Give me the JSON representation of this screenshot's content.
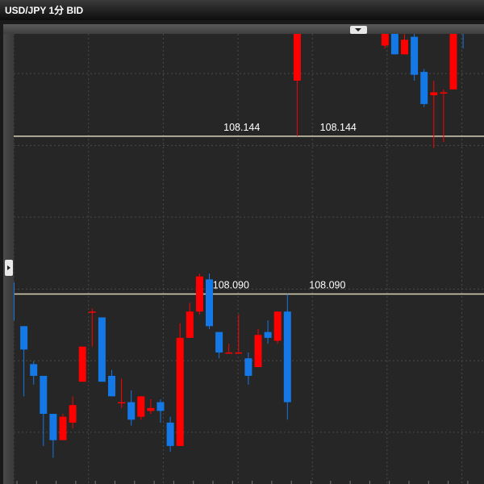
{
  "window": {
    "title": "USD/JPY 1分 BID"
  },
  "icons": {
    "dropdown": "caret-down-icon",
    "side_toggle": "caret-right-icon"
  },
  "colors": {
    "up": "#ff0000",
    "down": "#1478e6",
    "background": "#262626",
    "grid": "#4a4a4a",
    "level_line": "#d8d2b8",
    "label_text": "#ffffff"
  },
  "chart_data": {
    "type": "candlestick",
    "instrument": "USD/JPY",
    "timeframe": "1分",
    "price_type": "BID",
    "ylim": [
      108.025,
      108.179
    ],
    "bar_count": 48,
    "grid": true,
    "price_lines": [
      {
        "price": 108.144,
        "labels": [
          "108.144",
          "108.144"
        ]
      },
      {
        "price": 108.09,
        "labels": [
          "108.090",
          "108.090"
        ]
      }
    ],
    "candles": [
      {
        "o": null,
        "h": 108.094,
        "l": 108.081,
        "c": null
      },
      {
        "o": 108.079,
        "h": 108.079,
        "l": 108.055,
        "c": 108.071
      },
      {
        "o": 108.066,
        "h": 108.067,
        "l": 108.059,
        "c": 108.062
      },
      {
        "o": 108.062,
        "h": 108.062,
        "l": 108.038,
        "c": 108.049
      },
      {
        "o": 108.049,
        "h": 108.049,
        "l": 108.034,
        "c": 108.04
      },
      {
        "o": 108.04,
        "h": 108.049,
        "l": 108.04,
        "c": 108.048
      },
      {
        "o": 108.046,
        "h": 108.055,
        "l": 108.044,
        "c": 108.052
      },
      {
        "o": 108.06,
        "h": 108.072,
        "l": 108.06,
        "c": 108.072
      },
      {
        "o": 108.084,
        "h": 108.085,
        "l": 108.072,
        "c": 108.084
      },
      {
        "o": 108.082,
        "h": 108.082,
        "l": 108.06,
        "c": 108.06
      },
      {
        "o": 108.062,
        "h": 108.064,
        "l": 108.055,
        "c": 108.055
      },
      {
        "o": 108.053,
        "h": 108.061,
        "l": 108.051,
        "c": 108.053
      },
      {
        "o": 108.053,
        "h": 108.057,
        "l": 108.045,
        "c": 108.047
      },
      {
        "o": 108.048,
        "h": 108.055,
        "l": 108.047,
        "c": 108.055
      },
      {
        "o": 108.05,
        "h": 108.054,
        "l": 108.049,
        "c": 108.051
      },
      {
        "o": 108.053,
        "h": 108.054,
        "l": 108.046,
        "c": 108.05
      },
      {
        "o": 108.046,
        "h": 108.048,
        "l": 108.036,
        "c": 108.038
      },
      {
        "o": 108.038,
        "h": 108.08,
        "l": 108.038,
        "c": 108.075
      },
      {
        "o": 108.075,
        "h": 108.087,
        "l": 108.075,
        "c": 108.084
      },
      {
        "o": 108.084,
        "h": 108.097,
        "l": 108.083,
        "c": 108.096
      },
      {
        "o": 108.095,
        "h": 108.097,
        "l": 108.078,
        "c": 108.079
      },
      {
        "o": 108.077,
        "h": 108.077,
        "l": 108.068,
        "c": 108.07
      },
      {
        "o": 108.07,
        "h": 108.073,
        "l": 108.07,
        "c": 108.07
      },
      {
        "o": 108.07,
        "h": 108.083,
        "l": 108.07,
        "c": 108.07
      },
      {
        "o": 108.068,
        "h": 108.07,
        "l": 108.059,
        "c": 108.062
      },
      {
        "o": 108.065,
        "h": 108.078,
        "l": 108.065,
        "c": 108.076
      },
      {
        "o": 108.077,
        "h": 108.081,
        "l": 108.073,
        "c": 108.075
      },
      {
        "o": 108.074,
        "h": 108.083,
        "l": 108.073,
        "c": 108.084
      },
      {
        "o": 108.084,
        "h": 108.09,
        "l": 108.047,
        "c": 108.053
      },
      {
        "o": 108.163,
        "h": 108.179,
        "l": 108.144,
        "c": 108.179
      },
      {
        "o": null,
        "h": null,
        "l": null,
        "c": null
      },
      {
        "o": null,
        "h": null,
        "l": null,
        "c": null
      },
      {
        "o": null,
        "h": null,
        "l": null,
        "c": null
      },
      {
        "o": null,
        "h": null,
        "l": null,
        "c": null
      },
      {
        "o": null,
        "h": null,
        "l": null,
        "c": null
      },
      {
        "o": null,
        "h": null,
        "l": null,
        "c": null
      },
      {
        "o": null,
        "h": null,
        "l": null,
        "c": null
      },
      {
        "o": null,
        "h": null,
        "l": null,
        "c": null
      },
      {
        "o": 108.175,
        "h": 108.179,
        "l": 108.174,
        "c": 108.179
      },
      {
        "o": 108.179,
        "h": 108.179,
        "l": 108.172,
        "c": 108.172
      },
      {
        "o": 108.172,
        "h": 108.179,
        "l": 108.172,
        "c": 108.177
      },
      {
        "o": 108.178,
        "h": 108.179,
        "l": 108.163,
        "c": 108.165
      },
      {
        "o": 108.166,
        "h": 108.167,
        "l": 108.154,
        "c": 108.155
      },
      {
        "o": 108.158,
        "h": 108.163,
        "l": 108.14,
        "c": 108.159
      },
      {
        "o": 108.159,
        "h": 108.16,
        "l": 108.142,
        "c": 108.159
      },
      {
        "o": 108.16,
        "h": 108.179,
        "l": 108.16,
        "c": 108.179
      },
      {
        "o": null,
        "h": 108.179,
        "l": 108.174,
        "c": null
      }
    ]
  }
}
